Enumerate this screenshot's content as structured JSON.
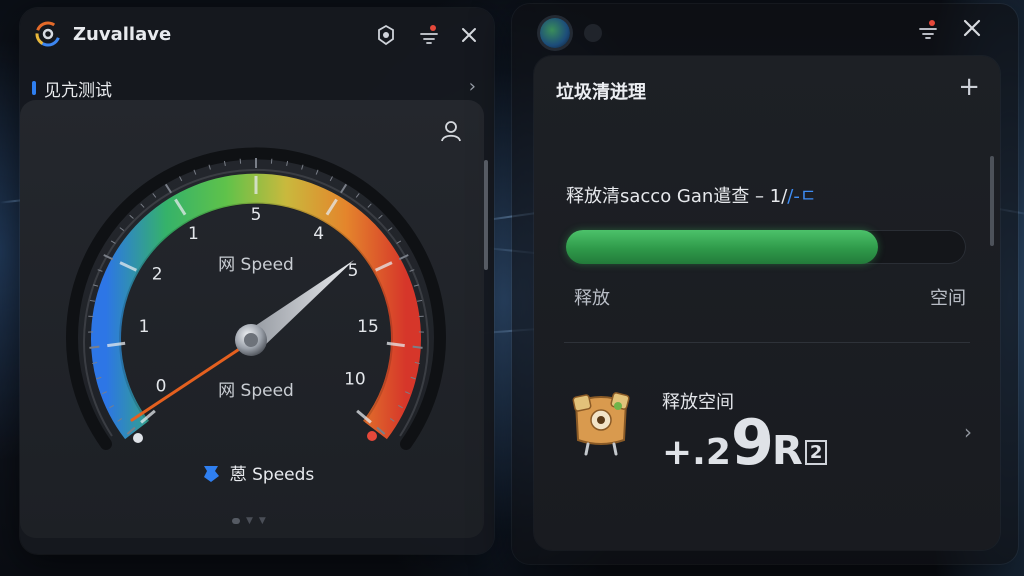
{
  "left_window": {
    "app_title": "Zuvallave",
    "titlebar_icons": [
      "bug-icon",
      "notification-icon",
      "close-icon"
    ],
    "nav": {
      "label": "见亢测试"
    },
    "gauge": {
      "inner_label_top": "网 Speed",
      "inner_label_bottom": "网 Speed",
      "scale_labels": [
        "0",
        "1",
        "2",
        "1",
        "5",
        "4",
        "5",
        "15",
        "10"
      ],
      "needle_value_label": "5",
      "footer_label": "蒽 Speeds"
    }
  },
  "right_window": {
    "card_title": "垃圾清迸理",
    "status_text_main": "释放清sacco Gan遣查 – 1/",
    "status_text_accent": "/-ㄷ",
    "progress": {
      "fraction": 0.78,
      "left_label": "释放",
      "right_label": "空间"
    },
    "freed": {
      "label": "释放空间",
      "value_prefix": "+.2",
      "value_main": "9",
      "value_unit": "R",
      "value_box": "2"
    }
  },
  "colors": {
    "accent_blue": "#2f7ff0",
    "progress_green": "#3eaf5c",
    "notification_red": "#e5483a",
    "needle_orange": "#e4601f"
  }
}
